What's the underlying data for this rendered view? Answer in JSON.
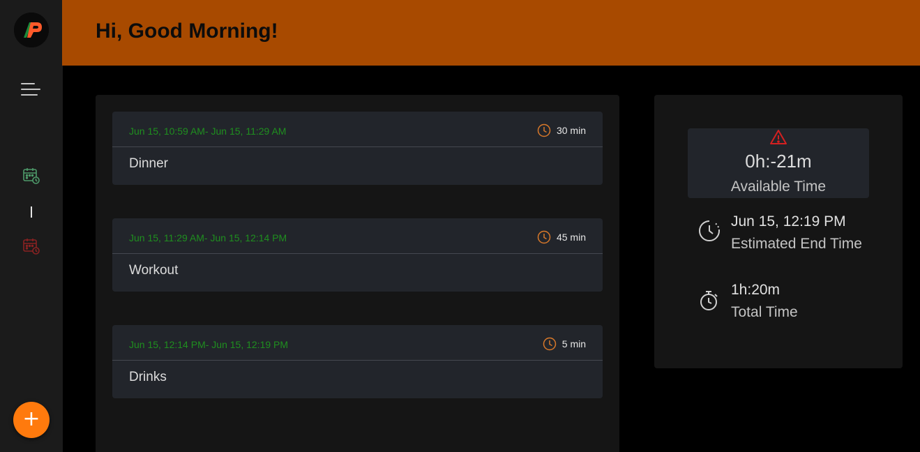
{
  "header": {
    "greeting": "Hi, Good Morning!"
  },
  "sidebar": {
    "logo_icon": "app-logo",
    "menu_icon": "hamburger-menu-icon",
    "nav": [
      {
        "icon": "calendar-clock-icon",
        "color": "#4e9a6a"
      },
      {
        "icon": "calendar-clock-icon",
        "color": "#8a2222"
      }
    ],
    "fab_label": "+",
    "fab_color": "#ff7a0d"
  },
  "tasks": [
    {
      "range": "Jun 15, 10:59 AM- Jun 15, 11:29 AM",
      "duration": "30 min",
      "title": "Dinner"
    },
    {
      "range": "Jun 15, 11:29 AM- Jun 15, 12:14 PM",
      "duration": "45 min",
      "title": "Workout"
    },
    {
      "range": "Jun 15, 12:14 PM- Jun 15, 12:19 PM",
      "duration": "5 min",
      "title": "Drinks"
    }
  ],
  "stats": {
    "available": {
      "value": "0h:-21m",
      "label": "Available Time",
      "icon": "warning-icon"
    },
    "end_time": {
      "value": "Jun 15, 12:19 PM",
      "label": "Estimated End Time",
      "icon": "clock-history-icon"
    },
    "total_time": {
      "value": "1h:20m",
      "label": "Total Time",
      "icon": "stopwatch-icon"
    }
  },
  "colors": {
    "header_bg": "#a84a00",
    "accent": "#ff7a0d",
    "range_text": "#1f8f1f",
    "warning": "#d42020",
    "duration_icon": "#d8782a"
  }
}
